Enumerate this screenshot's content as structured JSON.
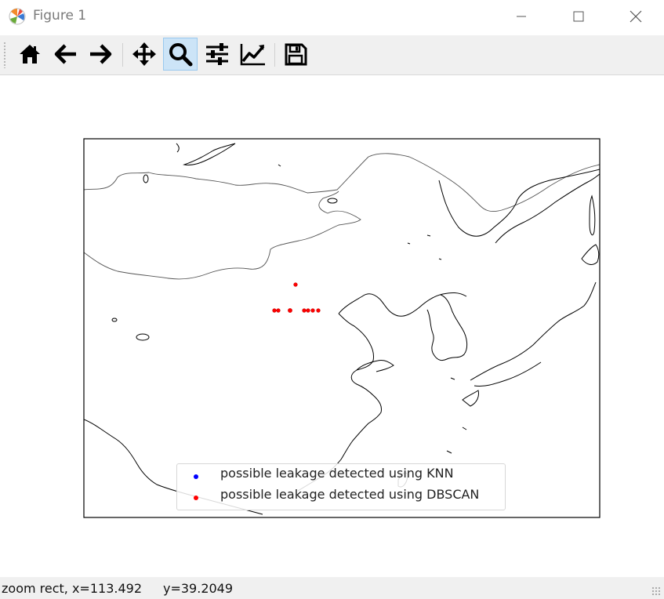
{
  "window": {
    "title": "Figure 1",
    "controls": [
      "minimize-icon",
      "maximize-icon",
      "close-icon"
    ]
  },
  "toolbar": {
    "buttons": [
      {
        "name": "home",
        "icon": "home-icon",
        "active": false
      },
      {
        "name": "back",
        "icon": "arrow-left-icon",
        "active": false
      },
      {
        "name": "forward",
        "icon": "arrow-right-icon",
        "active": false
      },
      {
        "name": "pan",
        "icon": "move-icon",
        "active": false
      },
      {
        "name": "zoom",
        "icon": "magnifier-icon",
        "active": true
      },
      {
        "name": "subplots",
        "icon": "sliders-icon",
        "active": false
      },
      {
        "name": "edit-axes",
        "icon": "line-chart-icon",
        "active": false
      },
      {
        "name": "save",
        "icon": "floppy-disk-icon",
        "active": false
      }
    ]
  },
  "plot": {
    "type": "map",
    "region": "East Asia (China, Mongolia, Korea, Japan)",
    "legend": {
      "position": "lower center",
      "entries": [
        {
          "label": "possible leakage detected using KNN",
          "color": "#0000ff"
        },
        {
          "label": "possible leakage detected using DBSCAN",
          "color": "#ff0000"
        }
      ]
    },
    "markers": [
      {
        "series": "DBSCAN",
        "color": "#ff0000",
        "count": 8
      }
    ]
  },
  "status": {
    "mode": "zoom rect",
    "x_text": "zoom rect, x=113.492",
    "y_text": "y=39.2049"
  }
}
